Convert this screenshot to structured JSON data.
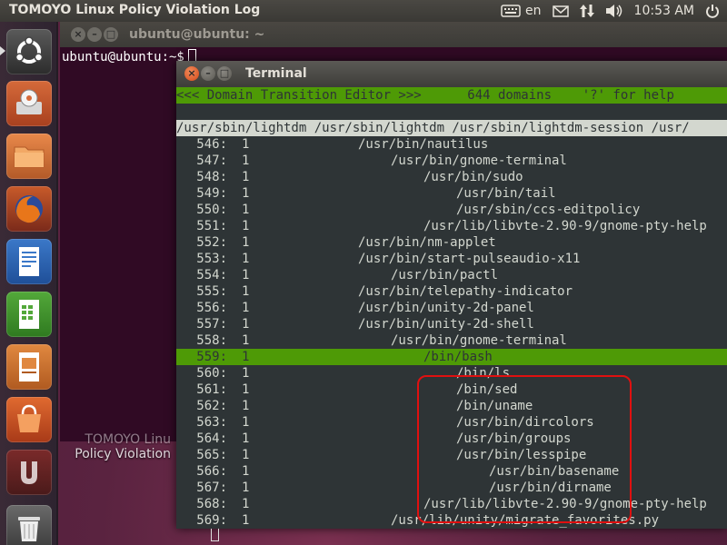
{
  "top_panel": {
    "app_title": "TOMOYO Linux Policy Violation Log",
    "keyboard_layout": "en",
    "clock": "10:53 AM",
    "icons": [
      "keyboard-icon",
      "mail-icon",
      "network-icon",
      "volume-icon",
      "power-icon"
    ]
  },
  "launcher": {
    "items": [
      {
        "name": "Dash home",
        "icon": "ubuntu-logo-icon"
      },
      {
        "name": "Install",
        "icon": "installer-icon"
      },
      {
        "name": "Home Folder",
        "icon": "folder-icon"
      },
      {
        "name": "Firefox",
        "icon": "firefox-icon"
      },
      {
        "name": "Writer",
        "icon": "writer-icon"
      },
      {
        "name": "Calc",
        "icon": "calc-icon"
      },
      {
        "name": "Impress",
        "icon": "impress-icon"
      },
      {
        "name": "Software Center",
        "icon": "software-center-icon"
      },
      {
        "name": "Unity",
        "icon": "unity-app-icon"
      },
      {
        "name": "Trash",
        "icon": "trash-icon"
      }
    ]
  },
  "back_window": {
    "title": "ubuntu@ubuntu: ~",
    "prompt": "ubuntu@ubuntu:~$",
    "behind_label_line1": "TOMOYO Linu",
    "behind_label_line2": "Policy Violation"
  },
  "terminal": {
    "title": "Terminal",
    "header": "<<< Domain Transition Editor >>>      644 domains    '?' for help",
    "path_line": "/usr/sbin/lightdm /usr/sbin/lightdm /usr/sbin/lightdm-session /usr/",
    "selected_index": 559,
    "rows": [
      {
        "num": "546:",
        "count": "1",
        "indent": 2,
        "path": "/usr/bin/nautilus"
      },
      {
        "num": "547:",
        "count": "1",
        "indent": 3,
        "path": "/usr/bin/gnome-terminal"
      },
      {
        "num": "548:",
        "count": "1",
        "indent": 4,
        "path": "/usr/bin/sudo"
      },
      {
        "num": "549:",
        "count": "1",
        "indent": 5,
        "path": "/usr/bin/tail"
      },
      {
        "num": "550:",
        "count": "1",
        "indent": 5,
        "path": "/usr/sbin/ccs-editpolicy"
      },
      {
        "num": "551:",
        "count": "1",
        "indent": 4,
        "path": "/usr/lib/libvte-2.90-9/gnome-pty-help"
      },
      {
        "num": "552:",
        "count": "1",
        "indent": 2,
        "path": "/usr/bin/nm-applet"
      },
      {
        "num": "553:",
        "count": "1",
        "indent": 2,
        "path": "/usr/bin/start-pulseaudio-x11"
      },
      {
        "num": "554:",
        "count": "1",
        "indent": 3,
        "path": "/usr/bin/pactl"
      },
      {
        "num": "555:",
        "count": "1",
        "indent": 2,
        "path": "/usr/bin/telepathy-indicator"
      },
      {
        "num": "556:",
        "count": "1",
        "indent": 2,
        "path": "/usr/bin/unity-2d-panel"
      },
      {
        "num": "557:",
        "count": "1",
        "indent": 2,
        "path": "/usr/bin/unity-2d-shell"
      },
      {
        "num": "558:",
        "count": "1",
        "indent": 3,
        "path": "/usr/bin/gnome-terminal"
      },
      {
        "num": "559:",
        "count": "1",
        "indent": 4,
        "path": "/bin/bash"
      },
      {
        "num": "560:",
        "count": "1",
        "indent": 5,
        "path": "/bin/ls"
      },
      {
        "num": "561:",
        "count": "1",
        "indent": 5,
        "path": "/bin/sed"
      },
      {
        "num": "562:",
        "count": "1",
        "indent": 5,
        "path": "/bin/uname"
      },
      {
        "num": "563:",
        "count": "1",
        "indent": 5,
        "path": "/usr/bin/dircolors"
      },
      {
        "num": "564:",
        "count": "1",
        "indent": 5,
        "path": "/usr/bin/groups"
      },
      {
        "num": "565:",
        "count": "1",
        "indent": 5,
        "path": "/usr/bin/lesspipe"
      },
      {
        "num": "566:",
        "count": "1",
        "indent": 6,
        "path": "/usr/bin/basename"
      },
      {
        "num": "567:",
        "count": "1",
        "indent": 6,
        "path": "/usr/bin/dirname"
      },
      {
        "num": "568:",
        "count": "1",
        "indent": 4,
        "path": "/usr/lib/libvte-2.90-9/gnome-pty-help"
      },
      {
        "num": "569:",
        "count": "1",
        "indent": 3,
        "path": "/usr/lib/unity/migrate_favorites.py"
      }
    ]
  },
  "colors": {
    "header_bg": "#4e9a06",
    "terminal_bg": "#2e3436",
    "terminal_fg": "#d3d7cf",
    "highlight_box": "#e01010"
  }
}
